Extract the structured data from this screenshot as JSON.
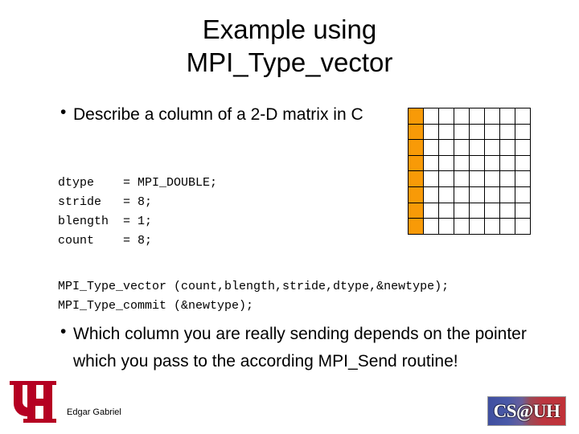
{
  "slide": {
    "title_line1": "Example using",
    "title_line2": "MPI_Type_vector",
    "bullets": [
      {
        "marker": "•",
        "text": "Describe a column of a 2-D matrix in C"
      },
      {
        "marker": "•",
        "text": "Which column you are really sending depends on the pointer which you pass to the according MPI_Send routine!"
      }
    ],
    "code_variables": "dtype    = MPI_DOUBLE;\nstride   = 8;\nblength  = 1;\ncount    = 8;",
    "code_calls": "MPI_Type_vector (count,blength,stride,dtype,&newtype);\nMPI_Type_commit (&newtype);",
    "footer_author": "Edgar Gabriel"
  },
  "matrix": {
    "rows": 8,
    "columns": 8,
    "highlighted_column_index": 0,
    "highlight_color": "#f89a07",
    "cell_border_color": "#000000",
    "cell_background": "#ffffff"
  },
  "logos": {
    "uh": {
      "label": "UH",
      "color": "#b50022"
    },
    "csuh": {
      "label": "CS@UH",
      "left_color": "#3f4fa0",
      "right_color": "#c13238",
      "text_color": "#ffffff"
    }
  }
}
